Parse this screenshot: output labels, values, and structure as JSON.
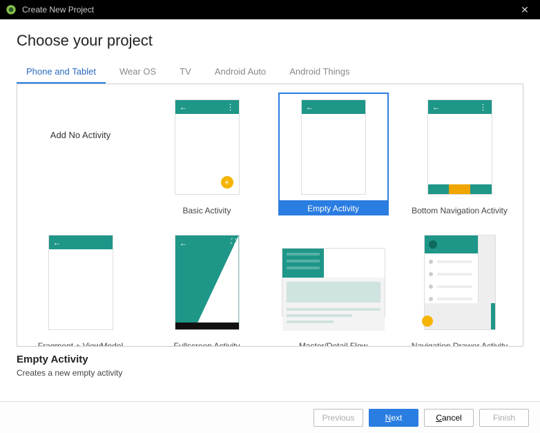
{
  "window": {
    "title": "Create New Project"
  },
  "header": {
    "title": "Choose your project"
  },
  "tabs": [
    {
      "label": "Phone and Tablet",
      "active": true
    },
    {
      "label": "Wear OS"
    },
    {
      "label": "TV"
    },
    {
      "label": "Android Auto"
    },
    {
      "label": "Android Things"
    }
  ],
  "templates": [
    {
      "label": "Add No Activity",
      "kind": "none"
    },
    {
      "label": "Basic Activity",
      "kind": "basic"
    },
    {
      "label": "Empty Activity",
      "kind": "empty",
      "selected": true
    },
    {
      "label": "Bottom Navigation Activity",
      "kind": "bottomnav"
    },
    {
      "label": "Fragment + ViewModel",
      "kind": "fragment"
    },
    {
      "label": "Fullscreen Activity",
      "kind": "fullscreen"
    },
    {
      "label": "Master/Detail Flow",
      "kind": "master"
    },
    {
      "label": "Navigation Drawer Activity",
      "kind": "navdrawer"
    }
  ],
  "selection": {
    "title": "Empty Activity",
    "description": "Creates a new empty activity"
  },
  "footer": {
    "previous": "Previous",
    "next": "Next",
    "cancel": "Cancel",
    "finish": "Finish"
  },
  "colors": {
    "accent": "#2a7de1",
    "teal": "#1e9688",
    "amber": "#f5b400"
  }
}
